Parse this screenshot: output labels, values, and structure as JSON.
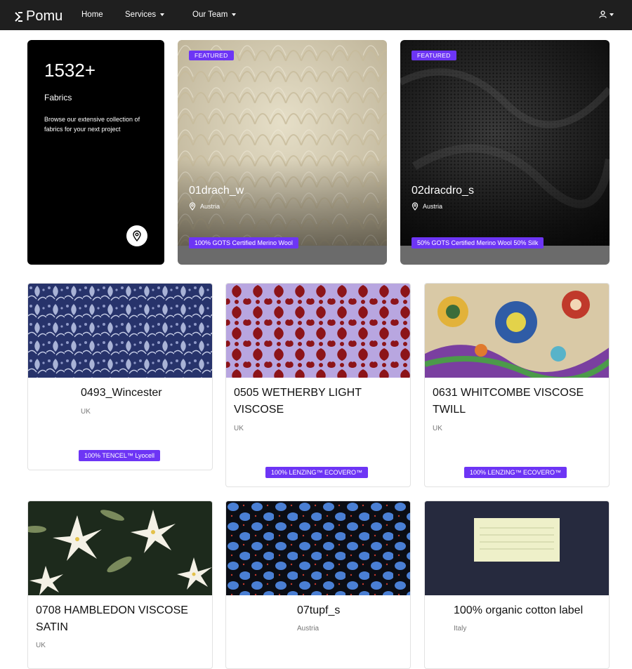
{
  "nav": {
    "logo": "Pomu",
    "home": "Home",
    "services": "Services",
    "team": "Our Team"
  },
  "stats": {
    "count": "1532+",
    "label": "Fabrics",
    "description": "Browse our extensive collection of fabrics for your next project"
  },
  "featured": [
    {
      "badge": "FEATURED",
      "name": "01drach_w",
      "location": "Austria",
      "composition": "100% GOTS Certified Merino Wool"
    },
    {
      "badge": "FEATURED",
      "name": "02dracdro_s",
      "location": "Austria",
      "composition": "50% GOTS Certified Merino Wool 50% Silk"
    }
  ],
  "fabrics": [
    {
      "title": "0493_Wincester",
      "origin": "UK",
      "composition": "100% TENCEL™ Lyocell"
    },
    {
      "title": "0505 WETHERBY LIGHT VISCOSE",
      "origin": "UK",
      "composition": "100% LENZING™ ECOVERO™"
    },
    {
      "title": "0631 WHITCOMBE VISCOSE TWILL",
      "origin": "UK",
      "composition": "100% LENZING™ ECOVERO™"
    },
    {
      "title": "0708 HAMBLEDON VISCOSE SATIN",
      "origin": "UK",
      "composition": ""
    },
    {
      "title": "07tupf_s",
      "origin": "Austria",
      "composition": ""
    },
    {
      "title": "100% organic cotton label",
      "origin": "Italy",
      "composition": ""
    }
  ],
  "colors": {
    "accent": "#6d35f5",
    "navbar": "#1f1f1f"
  }
}
